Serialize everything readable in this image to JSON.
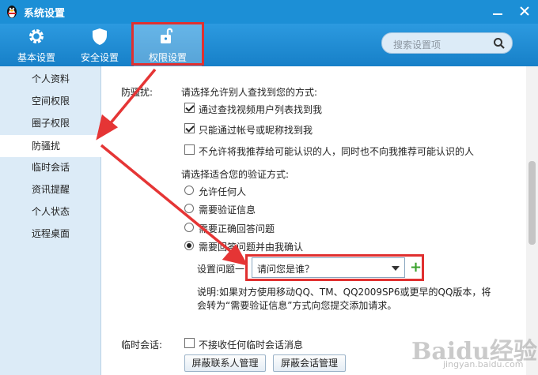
{
  "window": {
    "title": "系统设置"
  },
  "toolbar": {
    "items": [
      {
        "label": "基本设置"
      },
      {
        "label": "安全设置"
      },
      {
        "label": "权限设置"
      }
    ]
  },
  "search": {
    "placeholder": "搜索设置项"
  },
  "sidebar": {
    "items": [
      {
        "label": "个人资料"
      },
      {
        "label": "空间权限"
      },
      {
        "label": "圈子权限"
      },
      {
        "label": "防骚扰"
      },
      {
        "label": "临时会话"
      },
      {
        "label": "资讯提醒"
      },
      {
        "label": "个人状态"
      },
      {
        "label": "远程桌面"
      }
    ]
  },
  "antispam": {
    "section_label": "防骚扰:",
    "find_prompt": "请选择允许别人查找到您的方式:",
    "find_options": [
      {
        "label": "通过查找视频用户列表找到我",
        "checked": true
      },
      {
        "label": "只能通过帐号或昵称找到我",
        "checked": true
      },
      {
        "label": "不允许将我推荐给可能认识的人，同时也不向我推荐可能认识的人",
        "checked": false
      }
    ],
    "verify_prompt": "请选择适合您的验证方式:",
    "verify_options": [
      {
        "label": "允许任何人",
        "selected": false
      },
      {
        "label": "需要验证信息",
        "selected": false
      },
      {
        "label": "需要正确回答问题",
        "selected": false
      },
      {
        "label": "需要回答问题并由我确认",
        "selected": true
      }
    ],
    "question_label": "设置问题一:",
    "question_value": "请问您是谁？",
    "add_symbol": "+",
    "note_line1": "说明:如果对方使用移动QQ、TM、QQ2009SP6或更早的QQ版本，将",
    "note_line2": "会转为“需要验证信息”方式向您提交添加请求。"
  },
  "temp_session": {
    "section_label": "临时会话:",
    "reject_label": "不接收任何临时会话消息",
    "reject_checked": false,
    "block_contacts_button": "屏蔽联系人管理",
    "block_session_button": "屏蔽会话管理"
  },
  "watermark": {
    "main": "Baidu经验",
    "sub": "jingyan.baidu.com"
  },
  "colors": {
    "titlebar": "#1c8fd6",
    "sidebar": "#dcebf7",
    "highlight": "#e03030"
  }
}
